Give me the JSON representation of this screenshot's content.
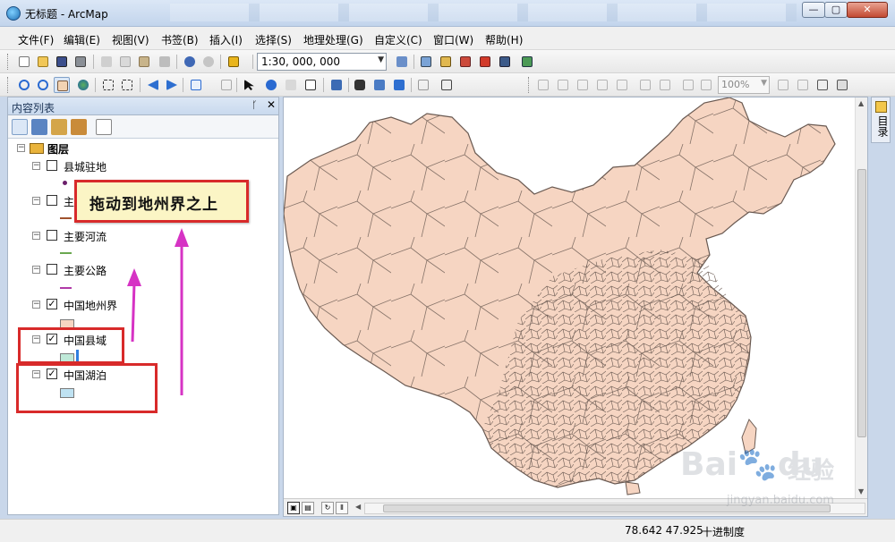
{
  "window": {
    "title": "无标题 - ArcMap",
    "min": "—",
    "max": "▢",
    "close": "✕"
  },
  "menu": [
    "文件(F)",
    "编辑(E)",
    "视图(V)",
    "书签(B)",
    "插入(I)",
    "选择(S)",
    "地理处理(G)",
    "自定义(C)",
    "窗口(W)",
    "帮助(H)"
  ],
  "toolbar": {
    "scale": "1:30, 000, 000",
    "zoom": "100%"
  },
  "toc": {
    "title": "内容列表",
    "pin": "ᚴ",
    "close": "✕",
    "group": "图层",
    "layers": [
      {
        "label": "县城驻地",
        "checked": false,
        "symbol": "point",
        "color": "#6b1f6b"
      },
      {
        "label": "主要",
        "checked": false,
        "symbol": "line",
        "color": "#a0522d"
      },
      {
        "label": "主要河流",
        "checked": false,
        "symbol": "line",
        "color": "#6aa84f"
      },
      {
        "label": "主要公路",
        "checked": false,
        "symbol": "line",
        "color": "#b03aa8"
      },
      {
        "label": "中国地州界",
        "checked": true,
        "symbol": "polygon",
        "color": "#f6d5c2"
      },
      {
        "label": "中国县域",
        "checked": true,
        "symbol": "polygon",
        "color": "#bfe9d8"
      },
      {
        "label": "中国湖泊",
        "checked": true,
        "symbol": "polygon",
        "color": "#bfe2f2"
      }
    ]
  },
  "callout": {
    "text": "拖动到地州界之上"
  },
  "map": {
    "fill": "#f6d5c2",
    "stroke": "#6a5a52"
  },
  "catalog_tab": {
    "label": "目录"
  },
  "status": {
    "coords": "78.642  47.925",
    "unit": "十进制度"
  },
  "watermark": {
    "logo": "Bai🐾du",
    "brand": "经验",
    "url": "jingyan.baidu.com"
  },
  "colors": {
    "highlight": "#d82a2a",
    "arrow": "#d633c4",
    "callout_bg": "#fbf5c5"
  }
}
